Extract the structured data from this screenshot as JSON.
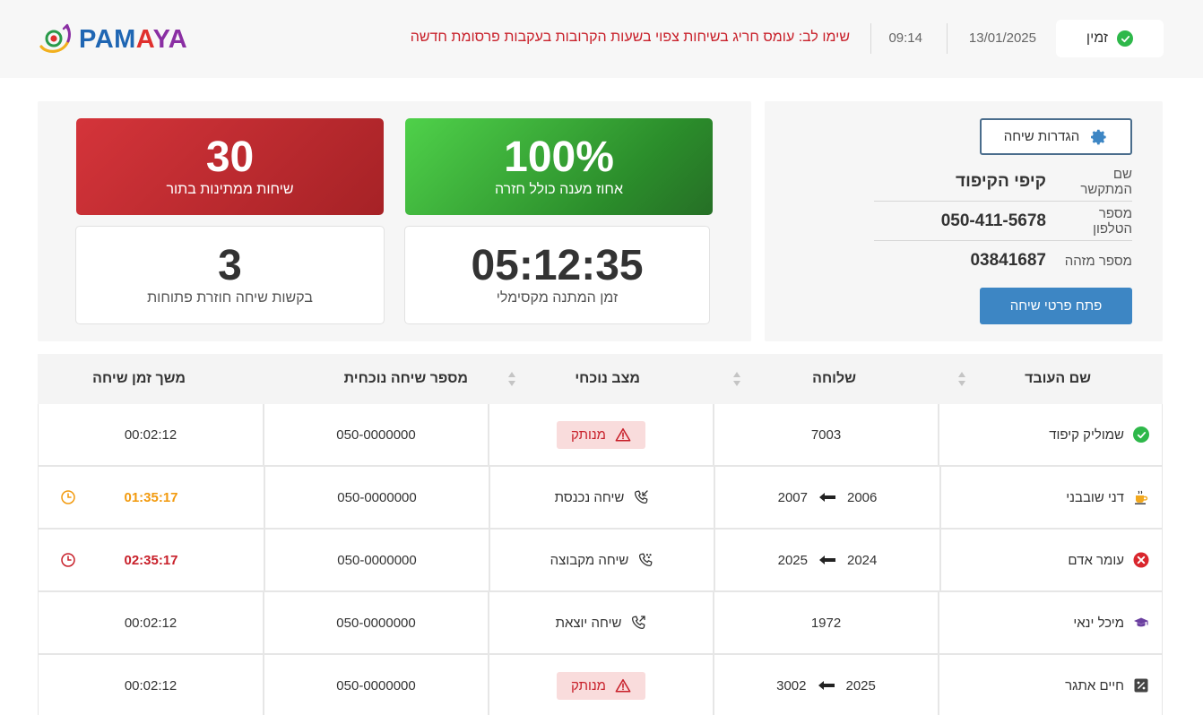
{
  "header": {
    "status_label": "זמין",
    "date": "13/01/2025",
    "time": "09:14",
    "alert": "שימו לב: עומס חריג בשיחות צפוי בשעות הקרובות בעקבות פרסומת חדשה",
    "logo_text": "PAMAYA"
  },
  "contact": {
    "settings_label": "הגדרות שיחה",
    "name_label": "שם המתקשר",
    "name_value": "קיפי הקיפוד",
    "phone_label": "מספר הטלפון",
    "phone_value": "050-411-5678",
    "id_label": "מספר מזהה",
    "id_value": "03841687",
    "open_label": "פתח פרטי שיחה"
  },
  "stats": {
    "answer_rate": {
      "value": "100%",
      "label": "אחוז מענה כולל חזרה"
    },
    "waiting_calls": {
      "value": "30",
      "label": "שיחות ממתינות בתור"
    },
    "max_wait": {
      "value": "05:12:35",
      "label": "זמן המתנה מקסימלי"
    },
    "callbacks": {
      "value": "3",
      "label": "בקשות שיחה חוזרת פתוחות"
    }
  },
  "table": {
    "headers": {
      "name": "שם העובד",
      "extension": "שלוחה",
      "state": "מצב נוכחי",
      "number": "מספר שיחה נוכחית",
      "duration": "משך זמן שיחה"
    },
    "rows": [
      {
        "name": "שמוליק קיפוד",
        "status_icon": "check-circle-icon",
        "ext": "7003",
        "ext_to": "",
        "state": "מנותק",
        "state_type": "disconnected",
        "number": "050-0000000",
        "duration": "00:02:12",
        "duration_style": "normal"
      },
      {
        "name": "דני שובבני",
        "status_icon": "coffee-icon",
        "ext": "2006",
        "ext_to": "2007",
        "state": "שיחה נכנסת",
        "state_type": "incoming",
        "number": "050-0000000",
        "duration": "01:35:17",
        "duration_style": "orange"
      },
      {
        "name": "עומר אדם",
        "status_icon": "x-circle-icon",
        "ext": "2024",
        "ext_to": "2025",
        "state": "שיחה מקבוצה",
        "state_type": "group",
        "number": "050-0000000",
        "duration": "02:35:17",
        "duration_style": "red"
      },
      {
        "name": "מיכל ינאי",
        "status_icon": "graduation-cap-icon",
        "ext": "1972",
        "ext_to": "",
        "state": "שיחה יוצאת",
        "state_type": "outgoing",
        "number": "050-0000000",
        "duration": "00:02:12",
        "duration_style": "normal"
      },
      {
        "name": "חיים אתגר",
        "status_icon": "percent-box-icon",
        "ext": "2025",
        "ext_to": "3002",
        "state": "מנותק",
        "state_type": "disconnected",
        "number": "050-0000000",
        "duration": "00:02:12",
        "duration_style": "normal"
      }
    ]
  },
  "colors": {
    "accent_blue": "#3d86c4",
    "alert_red": "#c8202a",
    "success_green": "#2eb84a",
    "warning_orange": "#f29a0e"
  }
}
